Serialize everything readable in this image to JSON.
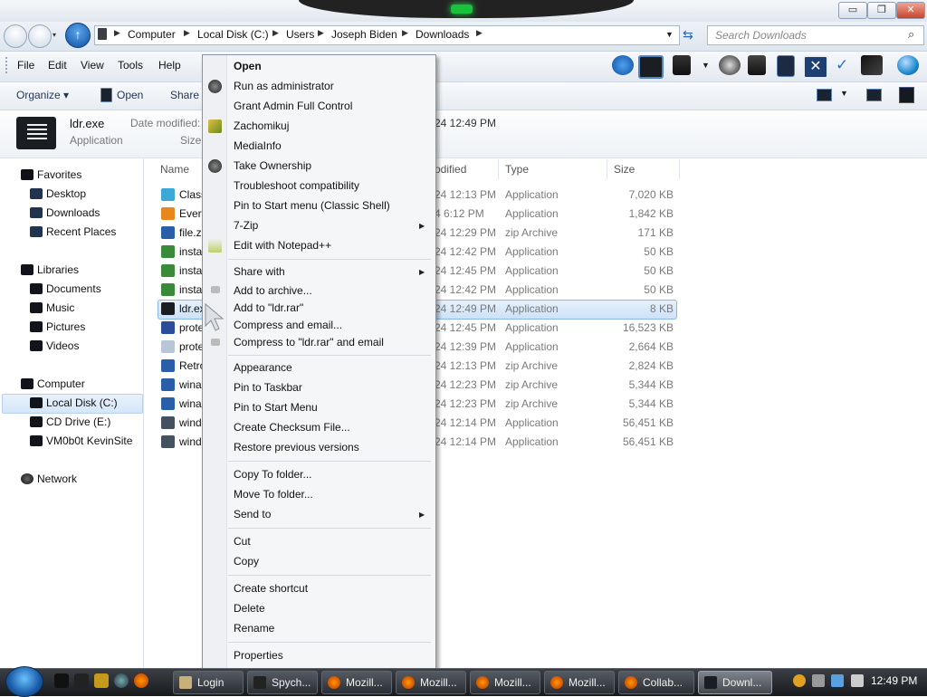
{
  "title_bar": {
    "minimize_label": "▭",
    "maximize_label": "❐",
    "close_label": "✕"
  },
  "address": {
    "crumbs": [
      "Computer",
      "Local Disk (C:)",
      "Users",
      "Joseph Biden",
      "Downloads"
    ],
    "search_placeholder": "Search Downloads"
  },
  "menu": [
    "File",
    "Edit",
    "View",
    "Tools",
    "Help"
  ],
  "command_bar": {
    "organize": "Organize ▾",
    "open": "Open",
    "share": "Share v"
  },
  "details": {
    "name": "ldr.exe",
    "kind": "Application",
    "modified_label": "Date modified:",
    "size_label": "Size:",
    "modified_value": "24 12:49 PM"
  },
  "nav": {
    "favorites": "Favorites",
    "desktop": "Desktop",
    "downloads": "Downloads",
    "recent": "Recent Places",
    "libraries": "Libraries",
    "documents": "Documents",
    "music": "Music",
    "pictures": "Pictures",
    "videos": "Videos",
    "computer": "Computer",
    "local_disk": "Local Disk (C:)",
    "cd_drive": "CD Drive (E:)",
    "vm": "VM0b0t KevinSite",
    "network": "Network"
  },
  "columns": {
    "name": "Name",
    "modified": "odified",
    "type": "Type",
    "size": "Size"
  },
  "files": [
    {
      "name": "Class",
      "modified": "24 12:13 PM",
      "type": "Application",
      "size": "7,020 KB"
    },
    {
      "name": "Every",
      "modified": "4 6:12 PM",
      "type": "Application",
      "size": "1,842 KB"
    },
    {
      "name": "file.z",
      "modified": "24 12:29 PM",
      "type": "zip Archive",
      "size": "171 KB"
    },
    {
      "name": "insta",
      "modified": "24 12:42 PM",
      "type": "Application",
      "size": "50 KB"
    },
    {
      "name": "insta",
      "modified": "24 12:45 PM",
      "type": "Application",
      "size": "50 KB"
    },
    {
      "name": "insta",
      "modified": "24 12:42 PM",
      "type": "Application",
      "size": "50 KB"
    },
    {
      "name": "ldr.ex",
      "modified": "24 12:49 PM",
      "type": "Application",
      "size": "8 KB"
    },
    {
      "name": "prote",
      "modified": "24 12:45 PM",
      "type": "Application",
      "size": "16,523 KB"
    },
    {
      "name": "prote",
      "modified": "24 12:39 PM",
      "type": "Application",
      "size": "2,664 KB"
    },
    {
      "name": "Retro",
      "modified": "24 12:13 PM",
      "type": "zip Archive",
      "size": "2,824 KB"
    },
    {
      "name": "wina",
      "modified": "24 12:23 PM",
      "type": "zip Archive",
      "size": "5,344 KB"
    },
    {
      "name": "wina",
      "modified": "24 12:23 PM",
      "type": "zip Archive",
      "size": "5,344 KB"
    },
    {
      "name": "wind",
      "modified": "24 12:14 PM",
      "type": "Application",
      "size": "56,451 KB"
    },
    {
      "name": "wind",
      "modified": "24 12:14 PM",
      "type": "Application",
      "size": "56,451 KB"
    }
  ],
  "context_menu": {
    "open": "Open",
    "run_admin": "Run as administrator",
    "grant_admin": "Grant Admin Full Control",
    "zachomikuj": "Zachomikuj",
    "mediainfo": "MediaInfo",
    "take_ownership": "Take Ownership",
    "troubleshoot": "Troubleshoot compatibility",
    "pin_start_classic": "Pin to Start menu (Classic Shell)",
    "seven_zip": "7-Zip",
    "notepad": "Edit with Notepad++",
    "share_with": "Share with",
    "add_archive": "Add to archive...",
    "add_ldr_rar": "Add to \"ldr.rar\"",
    "compress_email": "Compress and email...",
    "compress_ldr_email": "Compress to \"ldr.rar\" and email",
    "appearance": "Appearance",
    "pin_taskbar": "Pin to Taskbar",
    "pin_start": "Pin to Start Menu",
    "checksum": "Create Checksum File...",
    "restore": "Restore previous versions",
    "copy_to": "Copy To folder...",
    "move_to": "Move To folder...",
    "send_to": "Send to",
    "cut": "Cut",
    "copy": "Copy",
    "shortcut": "Create shortcut",
    "delete": "Delete",
    "rename": "Rename",
    "properties": "Properties"
  },
  "taskbar": {
    "buttons": [
      "Login",
      "Spych...",
      "Mozill...",
      "Mozill...",
      "Mozill...",
      "Mozill...",
      "Collab...",
      "Downl..."
    ],
    "clock": "12:49 PM"
  }
}
